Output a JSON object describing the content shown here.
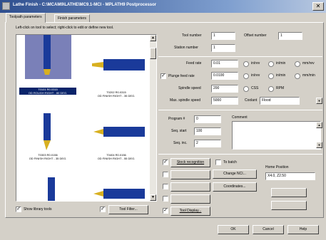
{
  "window": {
    "title": "Lathe Finish - C:\\MCAM9\\LATHE\\MC9.1-MCI - MPLATH9 Postprocessor",
    "close_glyph": "✕"
  },
  "tabs": [
    {
      "label": "Toolpath parameters"
    },
    {
      "label": "Finish parameters"
    }
  ],
  "gallery": {
    "instruction": "Left-click on tool to select; right-click to edit or define new tool.",
    "tools": [
      {
        "caption_1": "T0101 R0.0315",
        "caption_2": "OD ROUGH RIGHT - 80 DEG."
      },
      {
        "caption_1": "T0202 R0.0315",
        "caption_2": "OD FINISH RIGHT - 35 DEG."
      },
      {
        "caption_1": "T0303 R0.0156",
        "caption_2": "OD FINISH RIGHT - 35 DEG."
      },
      {
        "caption_1": "T0404 R0.0156",
        "caption_2": "OD FINISH RIGHT - 55 DEG."
      }
    ],
    "scroll_up": "▲",
    "scroll_down": "▼"
  },
  "bottom_left": {
    "show_library": "Show library tools",
    "tool_filter": "Tool Filter..."
  },
  "tool_info": {
    "tool_number_label": "Tool number",
    "tool_number_value": "1",
    "offset_number_label": "Offset number",
    "offset_number_value": "1",
    "station_number_label": "Station number",
    "station_number_value": "1"
  },
  "feeds": {
    "feed_rate_label": "Feed rate",
    "feed_rate_value": "0.01",
    "plunge_feed_label": "Plunge feed rate",
    "plunge_feed_value": "0.0100",
    "spindle_speed_label": "Spindle speed",
    "spindle_speed_value": "200",
    "max_spindle_label": "Max. spindle speed",
    "max_spindle_value": "5000",
    "in_rev": "in/rev",
    "in_min": "in/min",
    "mm_rev": "mm/rev",
    "mm_min": "mm/min",
    "css": "CSS",
    "rpm": "RPM",
    "coolant_label": "Coolant",
    "coolant_value": "Flood"
  },
  "misc": {
    "program_label": "Program #",
    "program_value": "0",
    "seq_start_label": "Seq. start",
    "seq_start_value": "100",
    "seq_inc_label": "Seq. inc.",
    "seq_inc_value": "2",
    "comment_label": "Comment"
  },
  "options": {
    "home_position": "Home Position",
    "home_position_value": "X4.0, Z2.50",
    "stock_recognition": "Stock recognition",
    "to_batch": "To batch",
    "change_nci": "Change NCI...",
    "coolant_btn": "Coordinates...",
    "tool_display": "Tool Display..."
  },
  "footer": {
    "ok": "OK",
    "cancel": "Cancel",
    "help": "Help"
  },
  "colors": {
    "face": "#d4d0c8",
    "selection": "#0a246a",
    "tool_blue": "#1a3a9a",
    "tool_gold": "#d8b020"
  }
}
